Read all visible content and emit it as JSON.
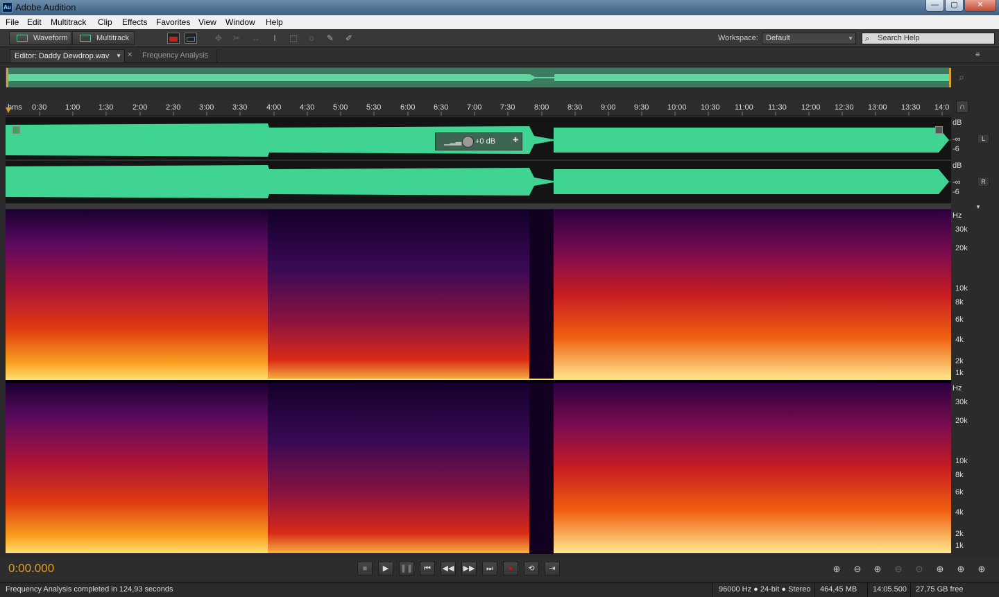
{
  "titlebar": {
    "logo": "Au",
    "title": "Adobe Audition",
    "min": "—",
    "max": "▢",
    "close": "✕"
  },
  "menu": [
    "File",
    "Edit",
    "Multitrack",
    "Clip",
    "Effects",
    "Favorites",
    "View",
    "Window",
    "Help"
  ],
  "toolbar": {
    "waveform_label": "Waveform",
    "multitrack_label": "Multitrack"
  },
  "workspace": {
    "label": "Workspace:",
    "value": "Default"
  },
  "search": {
    "placeholder": "Search Help"
  },
  "tabs": {
    "editor": "Editor: Daddy Dewdrop.wav",
    "freq": "Frequency Analysis"
  },
  "ruler": {
    "unit": "hms",
    "ticks": [
      "0:30",
      "1:00",
      "1:30",
      "2:00",
      "2:30",
      "3:00",
      "3:30",
      "4:00",
      "4:30",
      "5:00",
      "5:30",
      "6:00",
      "6:30",
      "7:00",
      "7:30",
      "8:00",
      "8:30",
      "9:00",
      "9:30",
      "10:00",
      "10:30",
      "11:00",
      "11:30",
      "12:00",
      "12:30",
      "13:00",
      "13:30",
      "14:0"
    ]
  },
  "hud": {
    "gain": "+0 dB"
  },
  "channels": {
    "left": "L",
    "right": "R",
    "db": "dB",
    "inf": "-∞",
    "m6": "-6"
  },
  "freq_axis": {
    "unit": "Hz",
    "labels": [
      "30k",
      "20k",
      "10k",
      "8k",
      "6k",
      "4k",
      "2k",
      "1k"
    ]
  },
  "timecode": "0:00.000",
  "status": {
    "message": "Frequency Analysis completed in 124,93 seconds",
    "format": "96000 Hz ● 24-bit ● Stereo",
    "size": "464,45 MB",
    "duration": "14:05.500",
    "free": "27,75 GB free"
  },
  "colors": {
    "waveform": "#3fd491",
    "timecode": "#e0a020",
    "record": "#cc1010"
  }
}
